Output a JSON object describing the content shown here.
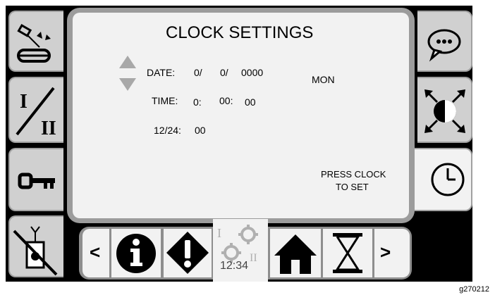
{
  "screen": {
    "title": "CLOCK SETTINGS",
    "date_label": "DATE:",
    "date_day": "0/",
    "date_month": "0/",
    "date_year": "0000",
    "weekday": "MON",
    "time_label": "TIME:",
    "time_hour": "0:",
    "time_minute": "00:",
    "time_second": "00",
    "format_label": "12/24:",
    "format_value": "00",
    "hint_line1": "PRESS CLOCK",
    "hint_line2": "TO SET"
  },
  "left_buttons": [
    {
      "icon": "belt-drive-icon"
    },
    {
      "icon": "range-I-II-icon"
    },
    {
      "icon": "key-icon"
    },
    {
      "icon": "remote-disabled-icon"
    }
  ],
  "right_buttons": [
    {
      "icon": "message-bubble-icon"
    },
    {
      "icon": "fullscreen-icon"
    },
    {
      "icon": "clock-icon",
      "selected": true
    }
  ],
  "bottom_bar": {
    "prev_label": "<",
    "next_label": ">",
    "settings_time": "12:34",
    "settings_marks": [
      "I",
      "II"
    ]
  },
  "figure_caption": "g270212",
  "colors": {
    "frame": "#000000",
    "panel": "#f2f2f2",
    "button": "#d0d0d0",
    "bezel": "#9c9c9c"
  }
}
